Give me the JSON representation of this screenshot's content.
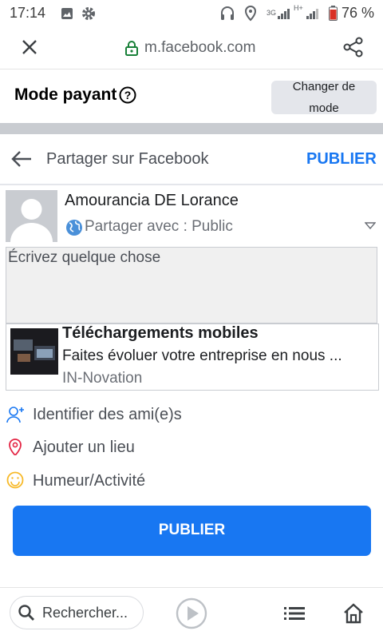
{
  "status_bar": {
    "time": "17:14",
    "battery": "76 %",
    "network": "3G",
    "network2": "H+"
  },
  "browser": {
    "url": "m.facebook.com",
    "close_icon": "close-icon",
    "lock_icon": "lock-icon",
    "share_icon": "share-icon"
  },
  "mode": {
    "title": "Mode payant",
    "change_line1": "Changer de",
    "change_line2": "mode"
  },
  "share_header": {
    "title": "Partager sur Facebook",
    "publish": "PUBLIER"
  },
  "profile": {
    "name": "Amourancia DE Lorance",
    "audience": "Partager avec : Public"
  },
  "composer": {
    "placeholder": "Écrivez quelque chose"
  },
  "link_card": {
    "title": "Téléchargements mobiles",
    "description": "Faites évoluer votre entreprise en nous ...",
    "source": "IN-Novation"
  },
  "actions": [
    {
      "label": "Identifier des ami(e)s",
      "icon": "tag-friends-icon",
      "color": "#1877f2"
    },
    {
      "label": "Ajouter un lieu",
      "icon": "location-pin-icon",
      "color": "#e42645"
    },
    {
      "label": "Humeur/Activité",
      "icon": "smiley-icon",
      "color": "#f7b928"
    }
  ],
  "publish_button": "PUBLIER",
  "bottom_nav": {
    "search_placeholder": "Rechercher...",
    "play_icon": "play-icon",
    "list_icon": "list-icon",
    "home_icon": "home-icon"
  },
  "colors": {
    "accent": "#1877f2",
    "separator": "#c9ccd1"
  }
}
